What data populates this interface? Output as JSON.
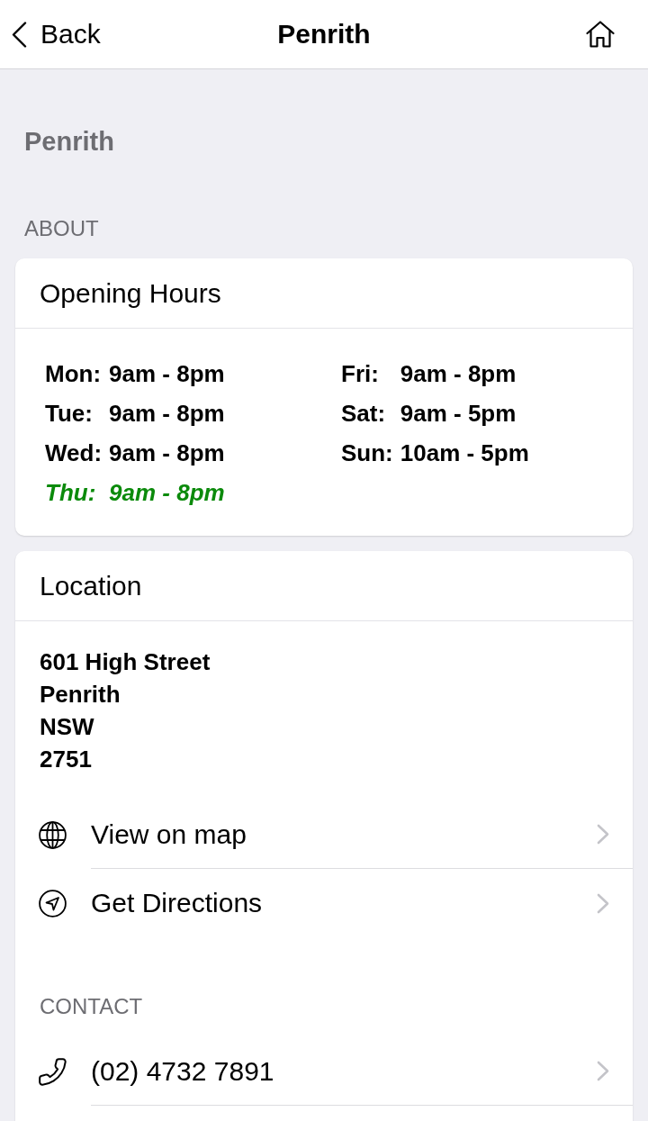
{
  "nav_bar": {
    "back": "Back",
    "title": "Penrith"
  },
  "heading": "Penrith",
  "section_label": "ABOUT",
  "opening_hours": {
    "title": "Opening Hours",
    "columns": [
      [
        {
          "day": "Mon:",
          "hours": "9am - 8pm",
          "today": false
        },
        {
          "day": "Tue:",
          "hours": "9am - 8pm",
          "today": false
        },
        {
          "day": "Wed:",
          "hours": "9am - 8pm",
          "today": false
        },
        {
          "day": "Thu:",
          "hours": "9am - 8pm",
          "today": true
        }
      ],
      [
        {
          "day": "Fri:",
          "hours": "9am - 8pm",
          "today": false
        },
        {
          "day": "Sat:",
          "hours": "9am - 5pm",
          "today": false
        },
        {
          "day": "Sun:",
          "hours": "10am - 5pm",
          "today": false
        }
      ]
    ]
  },
  "location": {
    "title": "Location",
    "address": [
      "601 High Street",
      "Penrith",
      "NSW",
      "2751"
    ],
    "actions": [
      {
        "kind": "map",
        "label": "View on map"
      },
      {
        "kind": "directions",
        "label": "Get Directions"
      }
    ]
  },
  "contact": {
    "label": "CONTACT",
    "items": [
      {
        "kind": "phone",
        "label": "(02) 4732 7891"
      }
    ]
  }
}
